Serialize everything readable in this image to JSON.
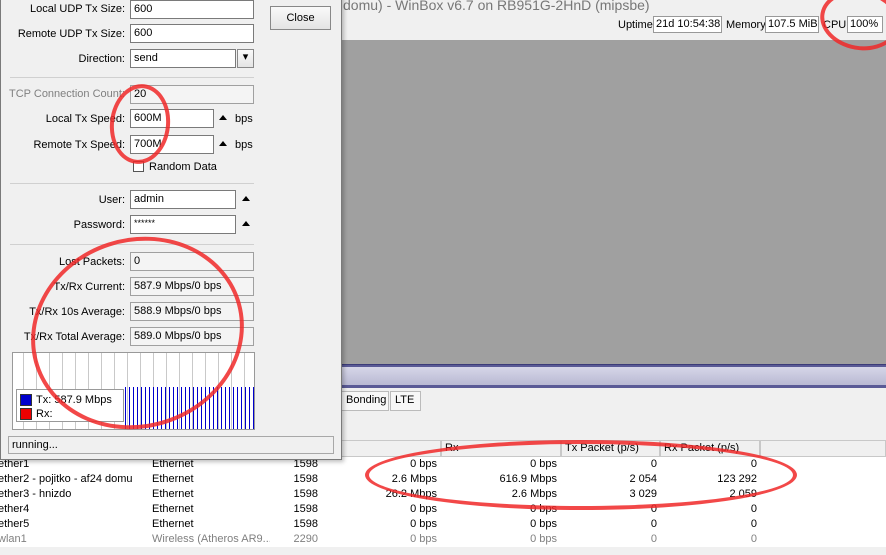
{
  "window": {
    "title": "domu) - WinBox v6.7 on RB951G-2HnD (mipsbe)"
  },
  "status": {
    "uptime_label": "Uptime:",
    "uptime": "21d 10:54:38",
    "memory_label": "Memory:",
    "memory": "107.5 MiB",
    "cpu_label": "CPU:",
    "cpu": "100%"
  },
  "tabs": [
    "Bonding",
    "LTE"
  ],
  "table": {
    "headers": [
      "Rx",
      "Tx Packet (p/s)",
      "Rx Packet (p/s)"
    ],
    "rows": [
      {
        "name": "ether1",
        "type": "Ethernet",
        "mtu": "1598",
        "tx": "0 bps",
        "rx": "0 bps",
        "txp": "0",
        "rxp": "0"
      },
      {
        "name": "ether2 - pojitko - af24 domu",
        "type": "Ethernet",
        "mtu": "1598",
        "tx": "2.6 Mbps",
        "rx": "616.9 Mbps",
        "txp": "2 054",
        "rxp": "123 292"
      },
      {
        "name": "ether3 - hnizdo",
        "type": "Ethernet",
        "mtu": "1598",
        "tx": "26.2 Mbps",
        "rx": "2.6 Mbps",
        "txp": "3 029",
        "rxp": "2 059"
      },
      {
        "name": "ether4",
        "type": "Ethernet",
        "mtu": "1598",
        "tx": "0 bps",
        "rx": "0 bps",
        "txp": "0",
        "rxp": "0"
      },
      {
        "name": "ether5",
        "type": "Ethernet",
        "mtu": "1598",
        "tx": "0 bps",
        "rx": "0 bps",
        "txp": "0",
        "rxp": "0"
      },
      {
        "name": "wlan1",
        "type": "Wireless (Atheros AR9...",
        "mtu": "2290",
        "tx": "0 bps",
        "rx": "0 bps",
        "txp": "0",
        "rxp": "0"
      }
    ]
  },
  "dialog": {
    "close_label": "Close",
    "local_udp_tx_size_label": "Local UDP Tx Size:",
    "local_udp_tx_size": "600",
    "remote_udp_tx_size_label": "Remote UDP Tx Size:",
    "remote_udp_tx_size": "600",
    "direction_label": "Direction:",
    "direction": "send",
    "tcp_conn_count_label": "TCP Connection Count:",
    "tcp_conn_count": "20",
    "local_tx_speed_label": "Local Tx Speed:",
    "local_tx_speed": "600M",
    "remote_tx_speed_label": "Remote Tx Speed:",
    "remote_tx_speed": "700M",
    "bps_unit": "bps",
    "random_data_label": "Random Data",
    "user_label": "User:",
    "user": "admin",
    "password_label": "Password:",
    "password": "******",
    "lost_packets_label": "Lost Packets:",
    "lost_packets": "0",
    "txrx_current_label": "Tx/Rx Current:",
    "txrx_current": "587.9 Mbps/0 bps",
    "txrx_10s_label": "Tx/Rx 10s Average:",
    "txrx_10s": "588.9 Mbps/0 bps",
    "txrx_total_label": "Tx/Rx Total Average:",
    "txrx_total": "589.0 Mbps/0 bps",
    "legend_tx": "Tx:  587.9 Mbps",
    "legend_rx": "Rx:",
    "status_text": "running..."
  },
  "colors": {
    "tx": "#0000cc",
    "rx": "#ee0000",
    "marker": "#f02828"
  }
}
